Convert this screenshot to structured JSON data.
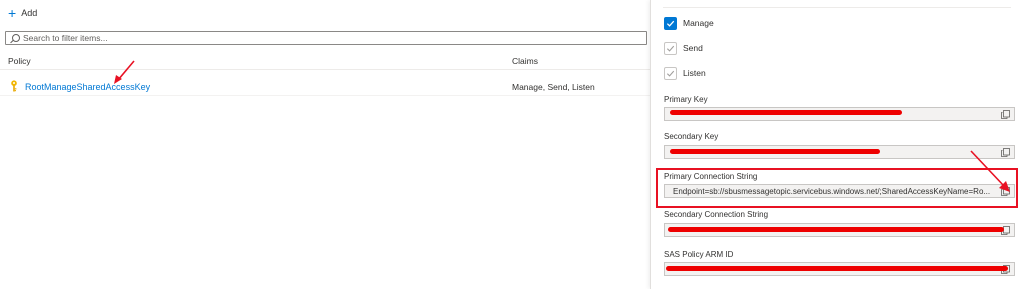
{
  "toolbar": {
    "add_label": "Add"
  },
  "filter": {
    "placeholder": "Search to filter items..."
  },
  "table": {
    "columns": {
      "policy": "Policy",
      "claims": "Claims"
    },
    "rows": [
      {
        "policy": "RootManageSharedAccessKey",
        "claims": "Manage, Send, Listen"
      }
    ]
  },
  "panel": {
    "checkboxes": [
      {
        "label": "Manage",
        "checked": true
      },
      {
        "label": "Send",
        "checked": true
      },
      {
        "label": "Listen",
        "checked": true
      }
    ],
    "fields": [
      {
        "label": "Primary Key",
        "value": ""
      },
      {
        "label": "Secondary Key",
        "value": ""
      },
      {
        "label": "Primary Connection String",
        "value": "Endpoint=sb://sbusmessagetopic.servicebus.windows.net/;SharedAccessKeyName=Ro..."
      },
      {
        "label": "Secondary Connection String",
        "value": ""
      },
      {
        "label": "SAS Policy ARM ID",
        "value": ""
      }
    ]
  },
  "colors": {
    "accent": "#0078d4",
    "annotation": "#e81123",
    "redaction": "#ee0000"
  }
}
